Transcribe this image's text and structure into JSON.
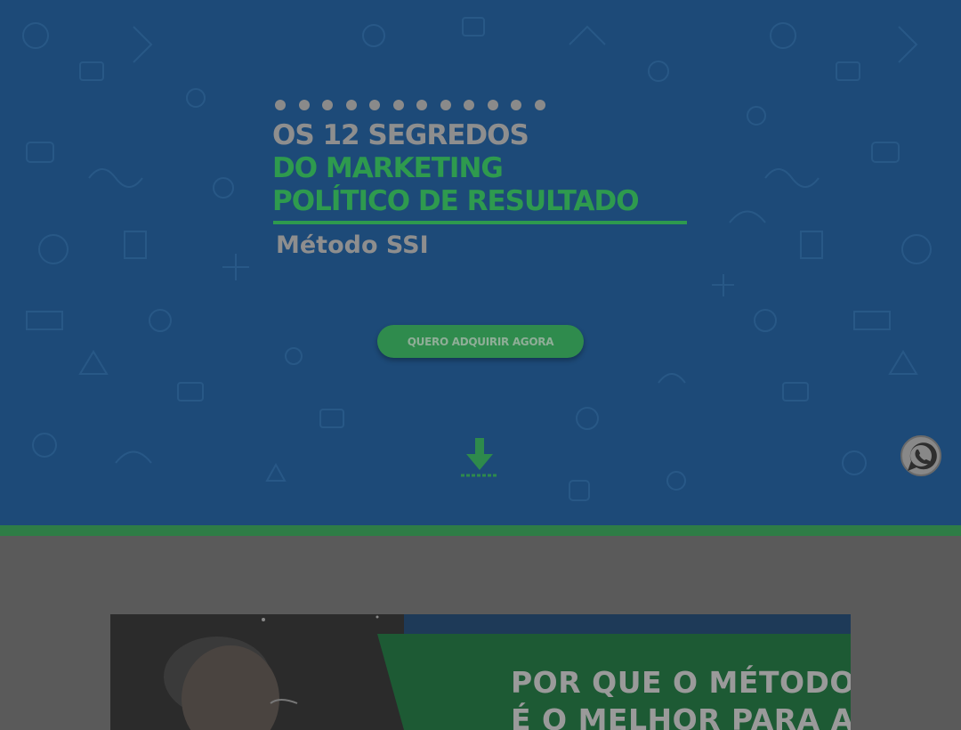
{
  "hero": {
    "title_line1": "OS 12 SEGREDOS",
    "title_line2": "DO MARKETING",
    "title_line3": "POLÍTICO DE RESULTADO",
    "subtitle": "Método SSI",
    "dot_count": 12,
    "cta_label": "QUERO ADQUIRIR AGORA",
    "scroll_icon": "download-arrow-icon"
  },
  "floating": {
    "whatsapp_icon": "whatsapp-icon"
  },
  "banner": {
    "line1": "POR QUE O MÉTODO SSI",
    "line2": "É O MELHOR PARA A"
  },
  "colors": {
    "hero_bg": "#1d4a78",
    "accent_green": "#2e9a4e",
    "overlay_gray": "#5a5a5a",
    "title_gray": "#8e8e8e"
  }
}
